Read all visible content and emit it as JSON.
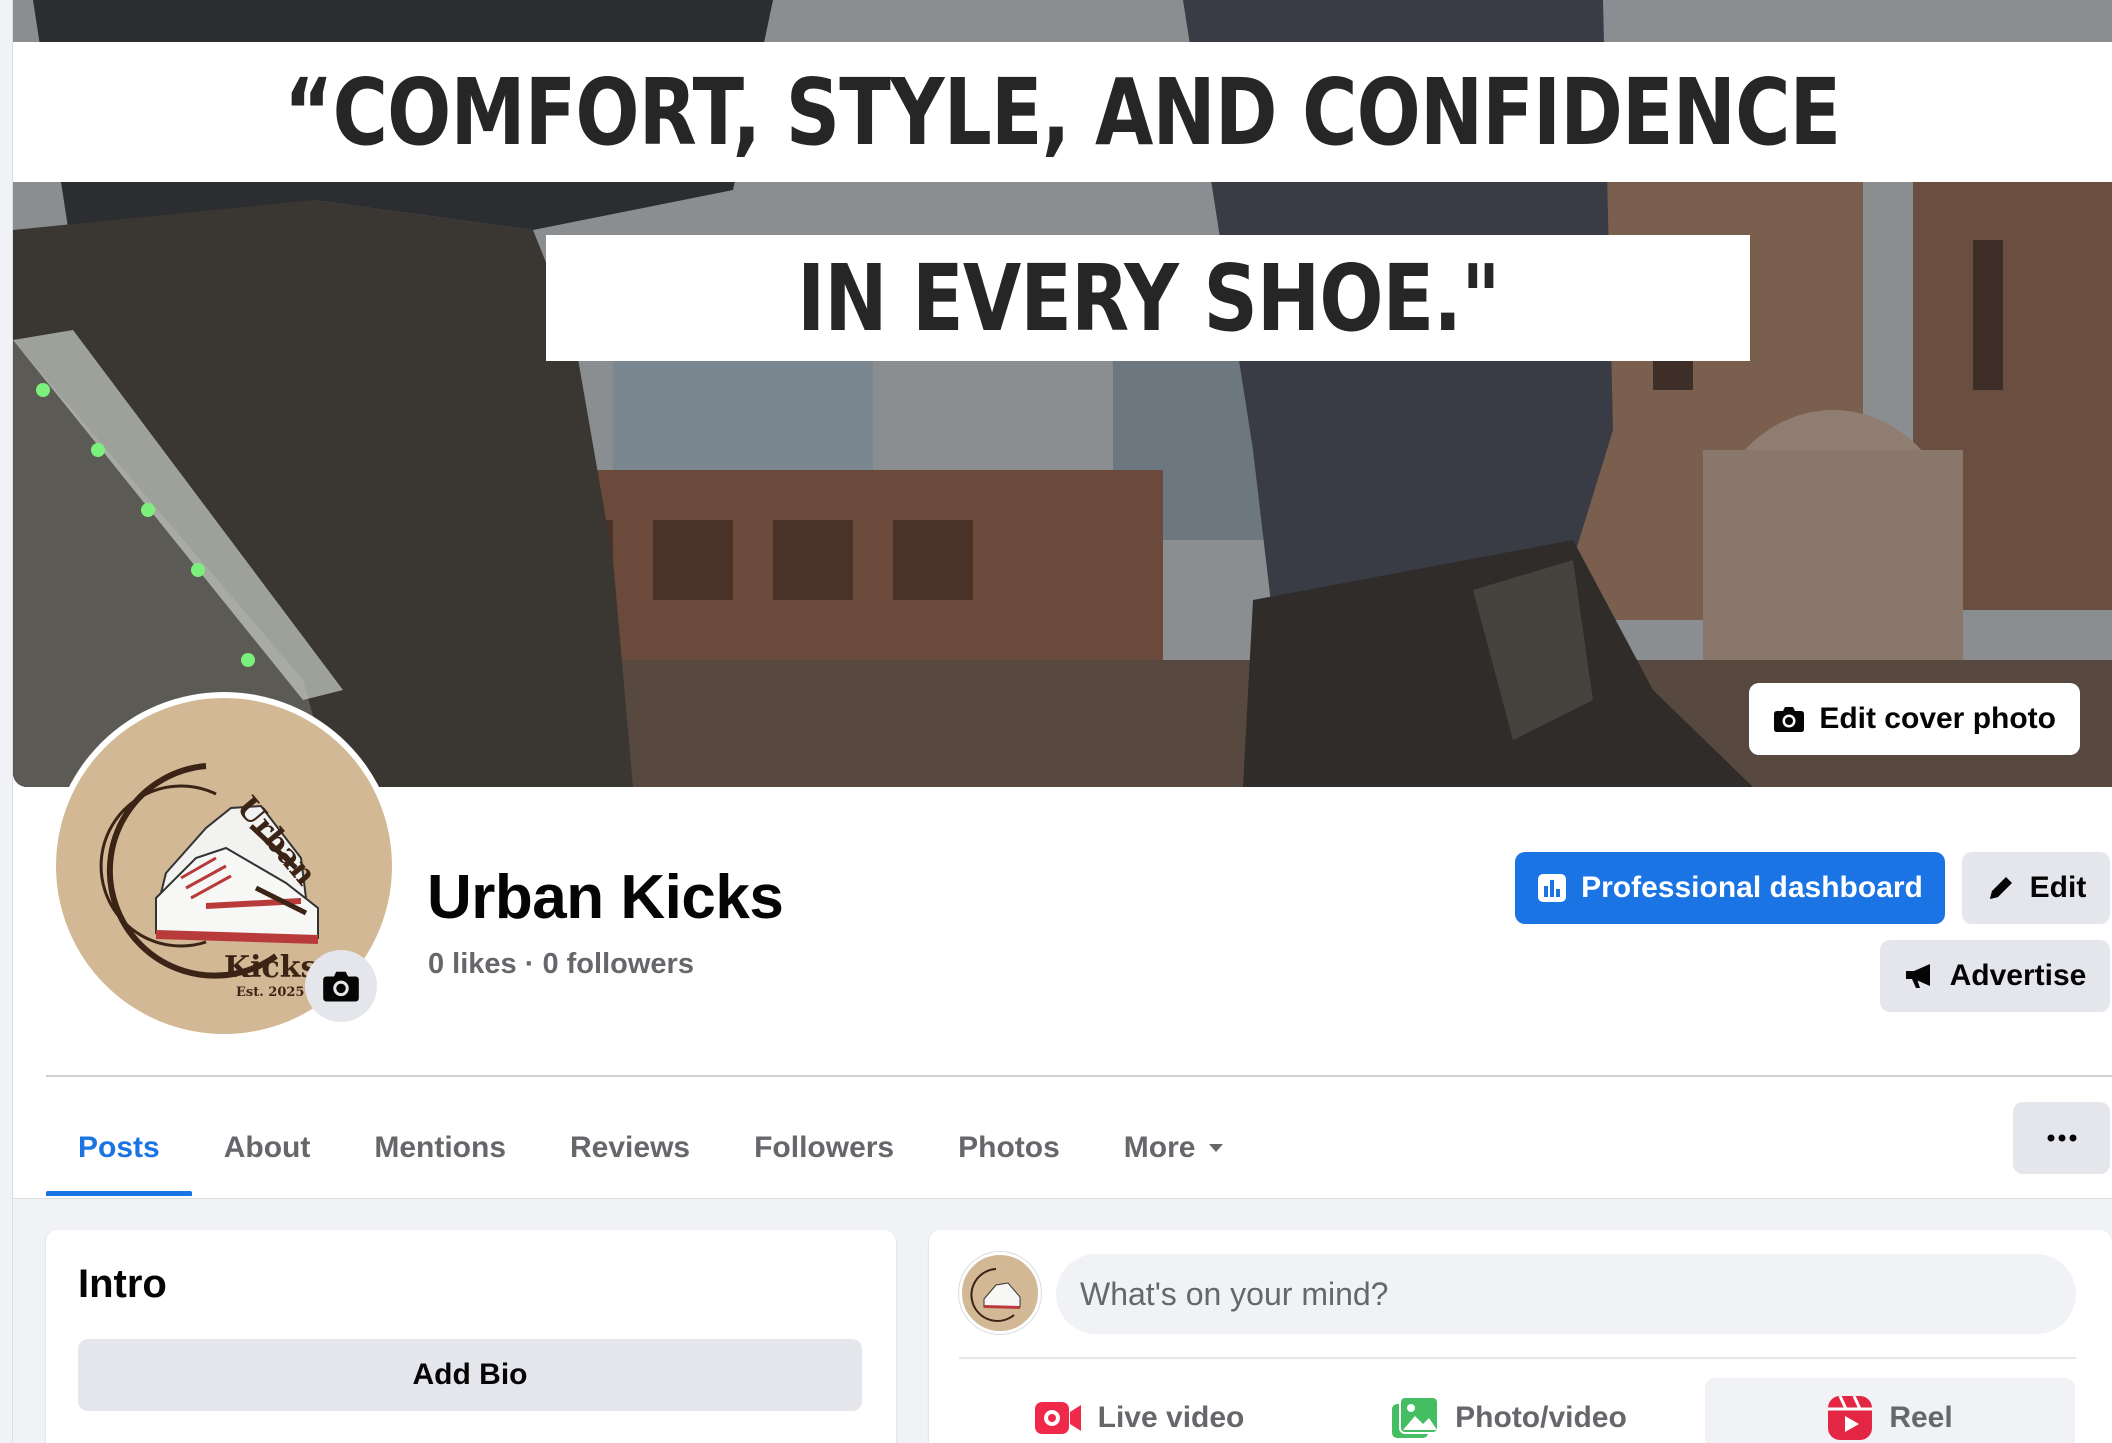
{
  "cover": {
    "quote_line_1": "“COMFORT, STYLE, AND CONFIDENCE",
    "quote_line_2": "IN EVERY SHOE.\"",
    "edit_cover_label": "Edit cover photo"
  },
  "logo": {
    "word_top": "Urban",
    "word_bottom": "Kicks",
    "est": "Est. 2025"
  },
  "profile": {
    "name": "Urban Kicks",
    "stats": "0 likes · 0 followers",
    "professional_dashboard_label": "Professional dashboard",
    "edit_label": "Edit",
    "advertise_label": "Advertise"
  },
  "tabs": [
    {
      "label": "Posts",
      "active": true
    },
    {
      "label": "About"
    },
    {
      "label": "Mentions"
    },
    {
      "label": "Reviews"
    },
    {
      "label": "Followers"
    },
    {
      "label": "Photos"
    },
    {
      "label": "More"
    }
  ],
  "intro": {
    "title": "Intro",
    "add_bio_label": "Add Bio"
  },
  "composer": {
    "placeholder": "What's on your mind?",
    "actions": [
      {
        "label": "Live video",
        "icon": "live-video-icon",
        "color": "#f02849"
      },
      {
        "label": "Photo/video",
        "icon": "photo-video-icon",
        "color": "#45bd62"
      },
      {
        "label": "Reel",
        "icon": "reel-icon",
        "color": "#e42645"
      }
    ]
  },
  "colors": {
    "accent": "#1b74e4",
    "logo_tan": "#d2b894",
    "logo_brown": "#4a2c1a"
  }
}
